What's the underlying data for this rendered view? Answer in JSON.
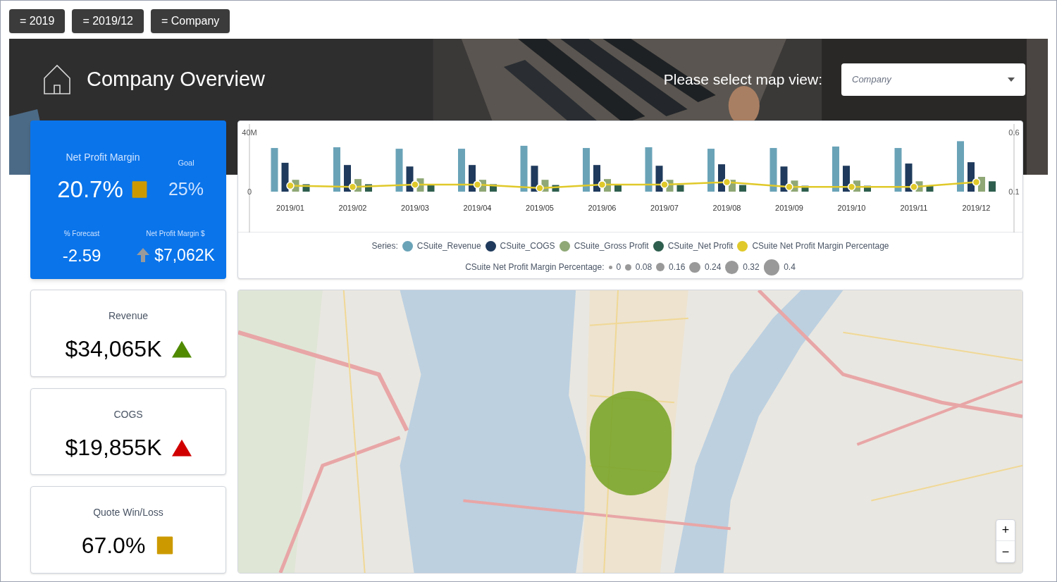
{
  "filters": [
    "= 2019",
    "= 2019/12",
    "= Company"
  ],
  "header": {
    "title": "Company Overview",
    "map_view_label": "Please select map view:",
    "map_view_select": {
      "value": "Company"
    }
  },
  "net_profit_card": {
    "title": "Net Profit Margin",
    "value": "20.7%",
    "indicator": {
      "kind": "square",
      "color": "#cc9a00"
    },
    "goal_label": "Goal",
    "goal_value": "25%",
    "forecast_label": "% Forecast",
    "forecast_value": "-2.59",
    "amount_label": "Net Profit Margin $",
    "amount_value": "$7,062K",
    "amount_indicator": {
      "kind": "arrow-up",
      "color": "#9a9a9a"
    }
  },
  "kpis": [
    {
      "label": "Revenue",
      "value": "$34,065K",
      "indicator": {
        "kind": "triangle-up",
        "color": "#4f8a00"
      }
    },
    {
      "label": "COGS",
      "value": "$19,855K",
      "indicator": {
        "kind": "triangle-up",
        "color": "#d10000"
      }
    },
    {
      "label": "Quote Win/Loss",
      "value": "67.0%",
      "indicator": {
        "kind": "square",
        "color": "#cc9a00"
      }
    }
  ],
  "chart": {
    "chart_data": {
      "type": "bar",
      "categories": [
        "2019/01",
        "2019/02",
        "2019/03",
        "2019/04",
        "2019/05",
        "2019/06",
        "2019/07",
        "2019/08",
        "2019/09",
        "2019/10",
        "2019/11",
        "2019/12"
      ],
      "ylim": [
        0,
        40
      ],
      "yticks": [
        {
          "value": 0,
          "label": "0"
        },
        {
          "value": 40,
          "label": "40M"
        }
      ],
      "series": [
        {
          "name": "CSuite_Revenue",
          "color": "#6aa3b8",
          "values": [
            29.5,
            30,
            29,
            29,
            31,
            29.5,
            30,
            29,
            29.5,
            30.5,
            29.5,
            34.1
          ]
        },
        {
          "name": "CSuite_COGS",
          "color": "#1f3a5c",
          "values": [
            19.5,
            18,
            17,
            18,
            17.5,
            18,
            17.5,
            18.5,
            17,
            17.5,
            19,
            19.9
          ]
        },
        {
          "name": "CSuite_Gross Profit",
          "color": "#8fa876",
          "values": [
            8,
            8.5,
            9,
            8,
            8,
            8.5,
            8,
            8,
            7.5,
            7.5,
            7,
            10
          ]
        },
        {
          "name": "CSuite_Net Profit",
          "color": "#2e5e4e",
          "values": [
            5,
            5,
            5,
            5,
            4.5,
            4.5,
            4.5,
            4.5,
            4,
            4,
            4,
            7
          ]
        }
      ]
    },
    "line_chart": {
      "chart_data": {
        "type": "line",
        "ylim": [
          0.1,
          0.6
        ],
        "yticks": [
          {
            "value": 0.1,
            "label": "0.1"
          },
          {
            "value": 0.6,
            "label": "0.6"
          }
        ],
        "series": [
          {
            "name": "CSuite Net Profit Margin Percentage",
            "color": "#e0c92a",
            "marker": "circle",
            "values": [
              0.15,
              0.14,
              0.16,
              0.16,
              0.13,
              0.16,
              0.16,
              0.18,
              0.14,
              0.14,
              0.14,
              0.18
            ]
          }
        ]
      }
    },
    "legend_label": "Series:",
    "size_legend": {
      "label": "CSuite Net Profit Margin Percentage:",
      "items": [
        "0",
        "0.08",
        "0.16",
        "0.24",
        "0.32",
        "0.4"
      ]
    }
  },
  "map": {
    "zoom_in": "+",
    "zoom_out": "−"
  }
}
